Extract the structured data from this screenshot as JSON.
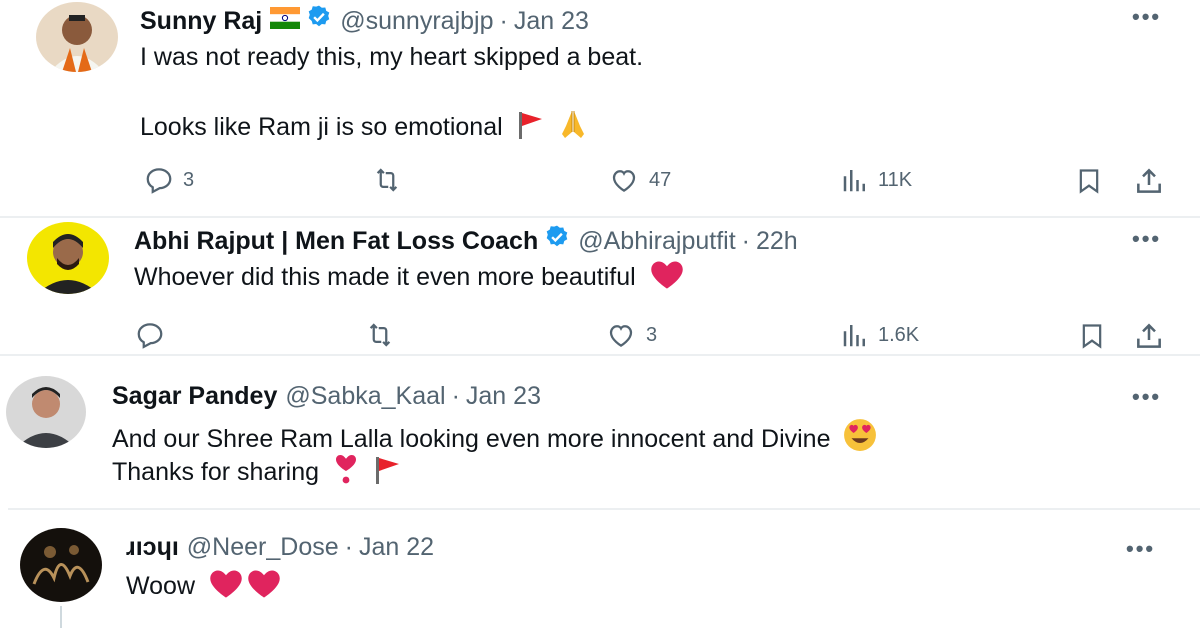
{
  "posts": [
    {
      "name": "Sunny Raj",
      "handle": "@sunnyrajbjp",
      "dot": "·",
      "time": "Jan 23",
      "line1": "I was not ready this, my heart skipped a beat.",
      "line2": "Looks like Ram ji is so emotional",
      "replies": "3",
      "likes": "47",
      "views": "11K"
    },
    {
      "name": "Abhi Rajput | Men Fat Loss Coach",
      "handle": "@Abhirajputfit",
      "dot": "·",
      "time": "22h",
      "line1": "Whoever did this made it even more beautiful",
      "replies": "",
      "likes": "3",
      "views": "1.6K"
    },
    {
      "name": "Sagar Pandey",
      "handle": "@Sabka_Kaal",
      "dot": "·",
      "time": "Jan 23",
      "line1": "And our Shree Ram Lalla looking even more innocent and Divine",
      "line2": "Thanks for sharing"
    },
    {
      "name": "ɹıɔɥı",
      "handle": "@Neer_Dose",
      "dot": "·",
      "time": "Jan 22",
      "line1": "Woow"
    }
  ],
  "more_label": "•••",
  "colors": {
    "verified": "#1d9bf0",
    "muted": "#536471",
    "heart": "#e0245e"
  },
  "icons": [
    "india-flag-icon",
    "verified-badge-icon",
    "red-flag-icon",
    "folded-hands-icon",
    "heart-emoji-icon",
    "heart-eyes-emoji-icon",
    "heart-exclamation-icon",
    "reply-icon",
    "repost-icon",
    "like-icon",
    "views-icon",
    "bookmark-icon",
    "share-icon",
    "more-icon"
  ]
}
